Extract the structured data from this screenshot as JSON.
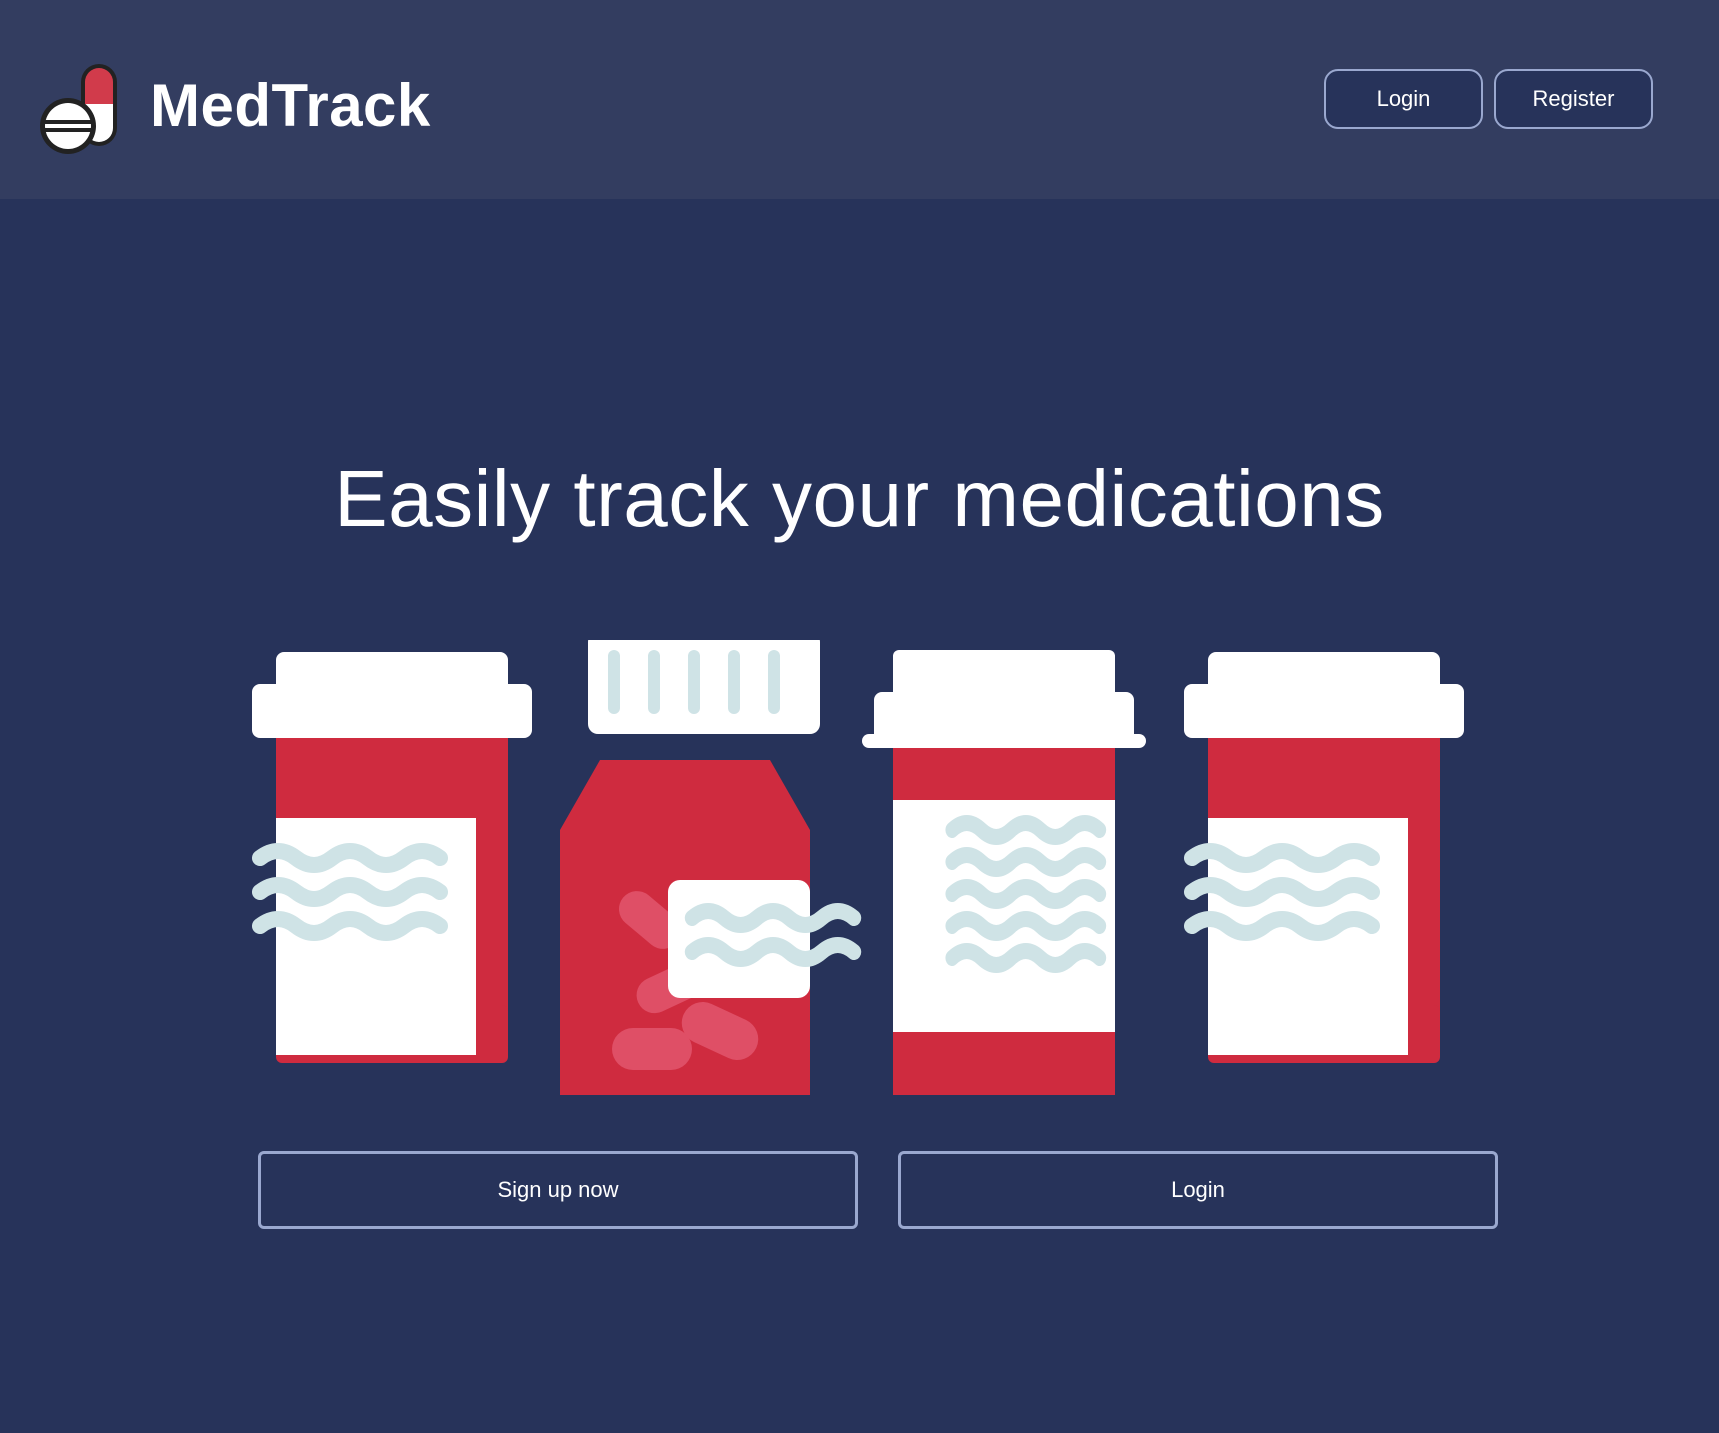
{
  "header": {
    "brand_name": "MedTrack",
    "login_label": "Login",
    "register_label": "Register"
  },
  "hero": {
    "title": "Easily track your medications",
    "signup_label": "Sign up now",
    "login_label": "Login"
  },
  "icons": {
    "logo": "pill-capsule-logo",
    "illustration": "medicine-bottles-illustration"
  },
  "colors": {
    "page_background": "#27335a",
    "header_background": "#333d60",
    "button_border": "#9aa8cf",
    "bottle_red": "#cf2b3f",
    "label_white": "#ffffff",
    "label_lines": "#cfe3e6"
  }
}
